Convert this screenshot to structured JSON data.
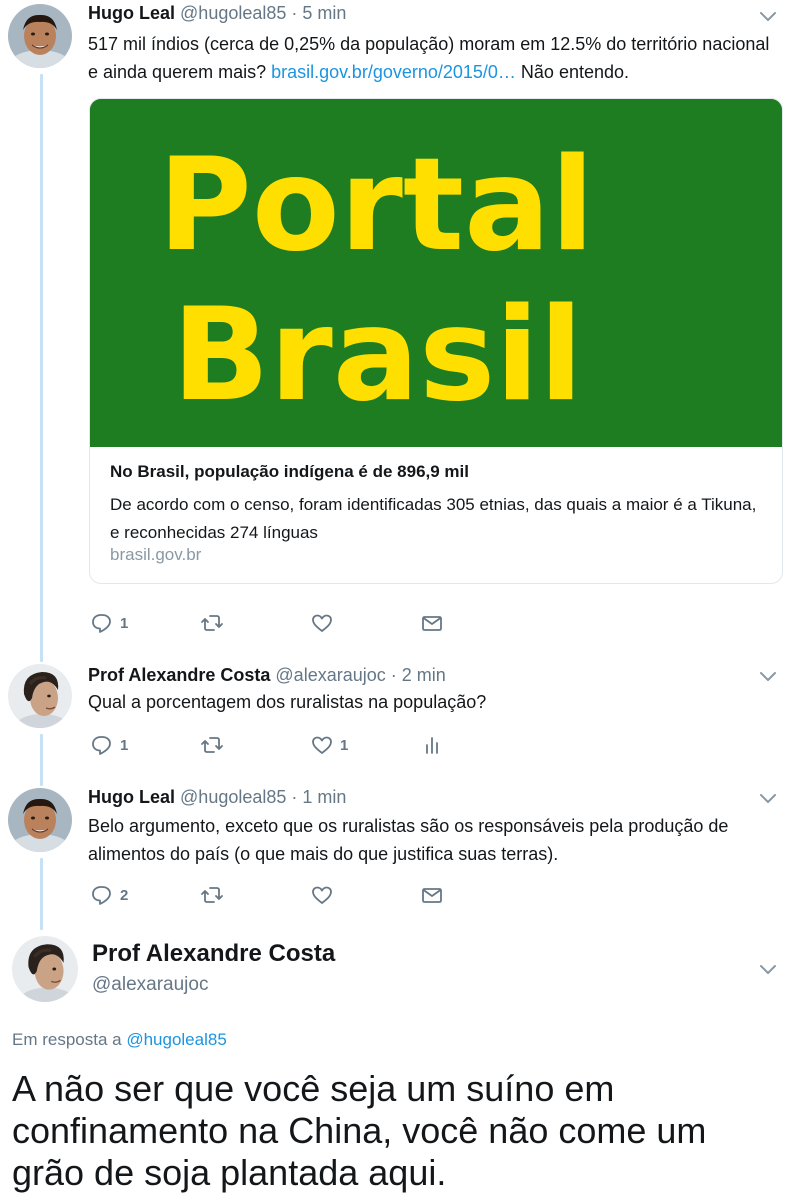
{
  "tweet1": {
    "name": "Hugo Leal",
    "handle": "@hugoleal85",
    "separator": "·",
    "time": "5 min",
    "text_before_link": "517 mil índios (cerca de 0,25% da população) moram em 12.5% do território nacional e ainda querem mais? ",
    "link_text": "brasil.gov.br/governo/2015/0…",
    "text_after_link": " Não entendo.",
    "card": {
      "image_line1": "Portal",
      "image_line2": "Brasil",
      "image_bg": "#1e7d21",
      "image_fg": "#ffdf00",
      "title": "No Brasil, população indígena é de 896,9 mil",
      "description": "De acordo com o censo, foram identificadas 305 etnias, das quais a maior é a Tikuna, e reconhecidas 274 línguas",
      "domain": "brasil.gov.br"
    },
    "reply_count": "1"
  },
  "tweet2": {
    "name": "Prof Alexandre Costa",
    "handle": "@alexaraujoc",
    "separator": "·",
    "time": "2 min",
    "text": "Qual a porcentagem dos ruralistas na população?",
    "reply_count": "1",
    "like_count": "1"
  },
  "tweet3": {
    "name": "Hugo Leal",
    "handle": "@hugoleal85",
    "separator": "·",
    "time": "1 min",
    "text": "Belo argumento, exceto que os ruralistas são os responsáveis pela produção de alimentos do país (o que mais do que justifica suas terras).",
    "reply_count": "2"
  },
  "main_tweet": {
    "name": "Prof Alexandre Costa",
    "handle": "@alexaraujoc",
    "reply_prefix": "Em resposta a ",
    "reply_mention": "@hugoleal85",
    "text": "A não ser que você seja um suíno em confinamento na China, você não come um grão de soja plantada aqui."
  },
  "colors": {
    "link": "#1b95e0",
    "secondary_text": "#657786",
    "thread_line": "#c4e2f4"
  },
  "icons": [
    "chevron-down-icon",
    "reply-icon",
    "retweet-icon",
    "like-icon",
    "direct-message-icon",
    "analytics-icon"
  ]
}
